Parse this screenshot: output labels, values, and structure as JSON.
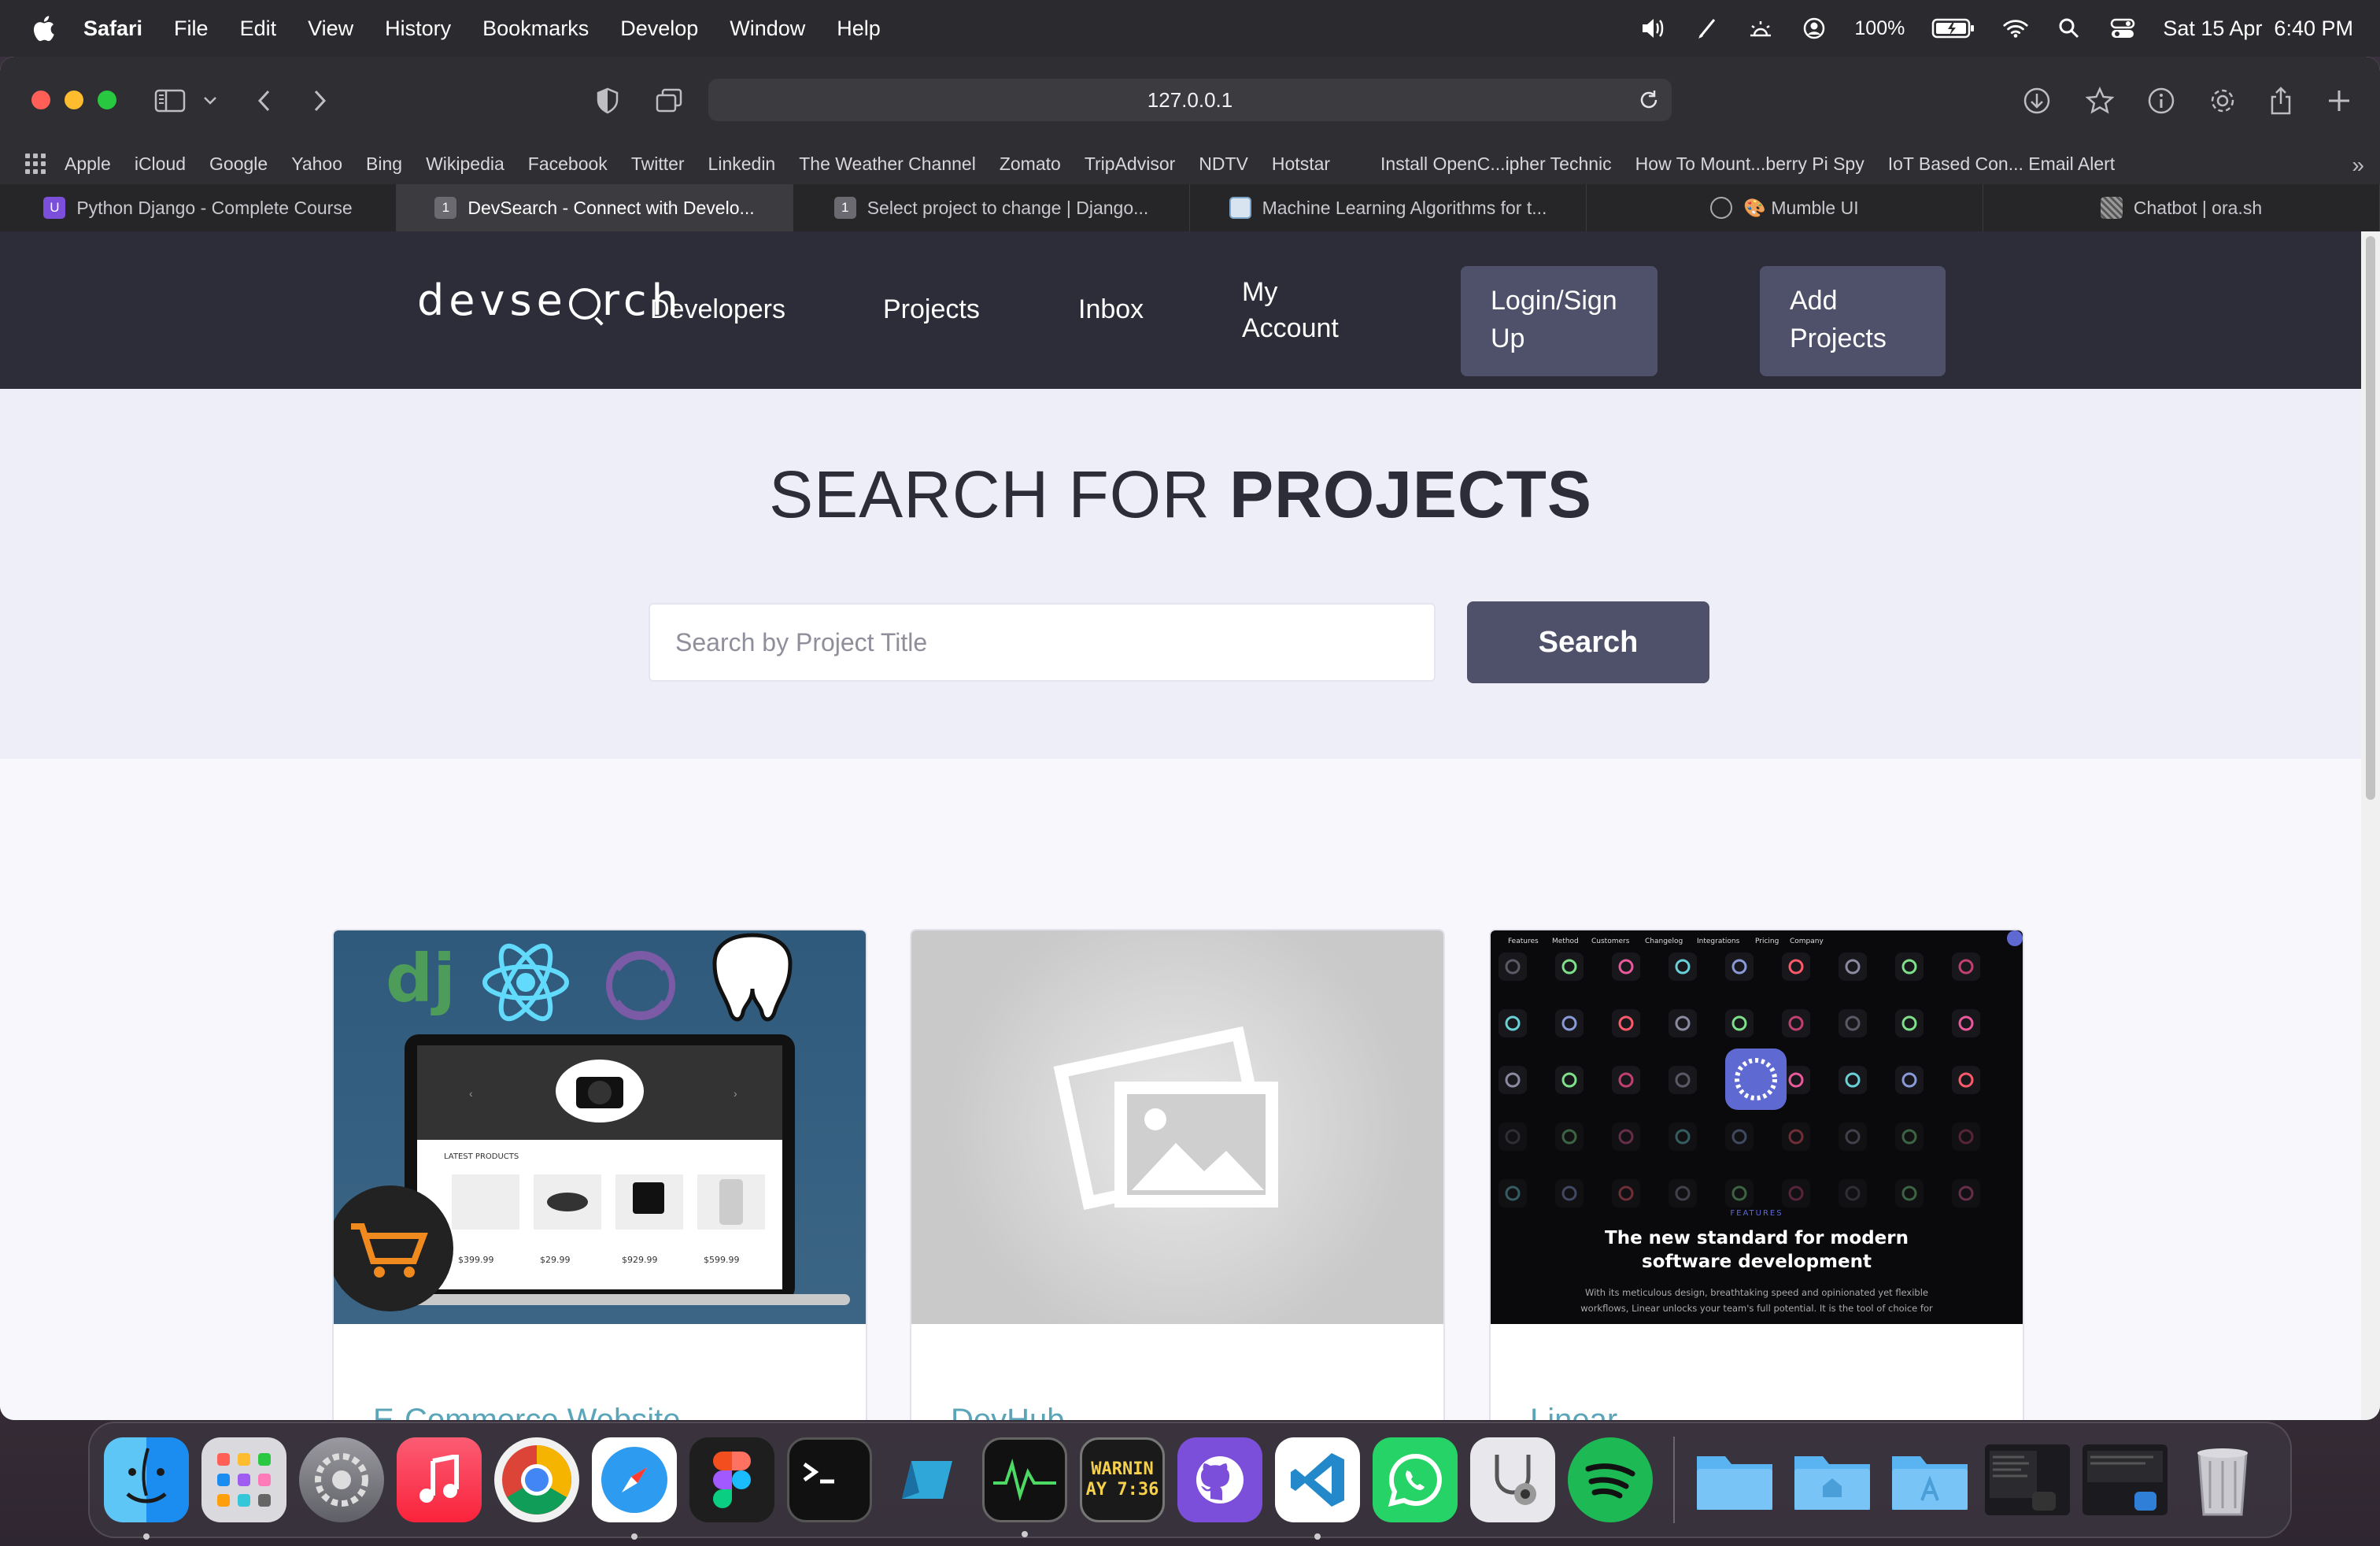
{
  "menubar": {
    "app_name": "Safari",
    "items": [
      "File",
      "Edit",
      "View",
      "History",
      "Bookmarks",
      "Develop",
      "Window",
      "Help"
    ],
    "battery": "100%",
    "datetime": "Sat 15 Apr  6:40 PM"
  },
  "browser": {
    "url": "127.0.0.1",
    "bookmarks": [
      "Apple",
      "iCloud",
      "Google",
      "Yahoo",
      "Bing",
      "Wikipedia",
      "Facebook",
      "Twitter",
      "Linkedin",
      "The Weather Channel",
      "Zomato",
      "TripAdvisor",
      "NDTV",
      "Hotstar",
      "Install OpenC...ipher Technic",
      "How To Mount...berry Pi Spy",
      "IoT Based Con... Email Alert"
    ],
    "tabs": [
      {
        "title": "Python Django - Complete Course",
        "fav_color": "#7b4fd9",
        "fav_text": "U",
        "active": false
      },
      {
        "title": "DevSearch - Connect with Develo...",
        "fav_color": "#6a6a70",
        "fav_text": "1",
        "active": true
      },
      {
        "title": "Select project to change | Django...",
        "fav_color": "#6a6a70",
        "fav_text": "1",
        "active": false
      },
      {
        "title": "Machine Learning Algorithms for t...",
        "fav_color": "#d8e4f0",
        "fav_text": "",
        "active": false
      },
      {
        "title": "🎨 Mumble UI",
        "fav_color": "transparent",
        "fav_text": "",
        "active": false
      },
      {
        "title": "Chatbot | ora.sh",
        "fav_color": "#8a8a8a",
        "fav_text": "",
        "active": false
      }
    ]
  },
  "site": {
    "logo": {
      "before": "devse",
      "after": "rch"
    },
    "nav": {
      "developers": "Developers",
      "projects": "Projects",
      "inbox": "Inbox",
      "account_line1": "My",
      "account_line2": "Account",
      "login_line1": "Login/Sign",
      "login_line2": "Up",
      "add_line1": "Add",
      "add_line2": "Projects"
    },
    "hero": {
      "title_light": "SEARCH FOR ",
      "title_bold": "PROJECTS",
      "search_placeholder": "Search by Project Title",
      "search_button": "Search"
    },
    "projects": [
      {
        "title": "E-Commerce Website"
      },
      {
        "title": "DevHub"
      },
      {
        "title": "Linear"
      }
    ],
    "ecom_thumb": {
      "latest": "LATEST PRODUCTS",
      "prices": [
        "$399.99",
        "$29.99",
        "$929.99",
        "$599.99"
      ]
    },
    "linear_thumb": {
      "nav": [
        "Features",
        "Method",
        "Customers",
        "Changelog",
        "Integrations",
        "Pricing",
        "Company"
      ],
      "eyebrow": "FEATURES",
      "headline_1": "The new standard for modern",
      "headline_2": "software development",
      "body_1": "With its meticulous design, breathtaking speed and opinionated yet flexible",
      "body_2": "workflows, Linear unlocks your team's full potential. It is the tool of choice for"
    }
  },
  "dock": {
    "console_text_1": "WARNIN",
    "console_text_2": "AY 7:36"
  },
  "colors": {
    "site_nav_bg": "#2d2d39",
    "accent_button": "#4f5069",
    "project_title": "#5aa5b9"
  }
}
